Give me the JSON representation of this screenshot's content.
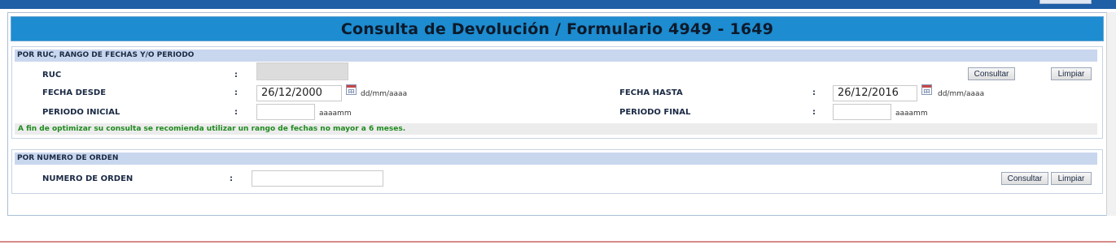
{
  "page_title": "Consulta de Devolución / Formulario 4949 - 1649",
  "colon": ":",
  "section_ruc": {
    "heading": "POR RUC, RANGO DE FECHAS Y/O PERIODO",
    "ruc_label": "RUC",
    "fecha_desde_label": "FECHA DESDE",
    "fecha_desde_value": "26/12/2000",
    "fecha_desde_hint": "dd/mm/aaaa",
    "fecha_hasta_label": "FECHA HASTA",
    "fecha_hasta_value": "26/12/2016",
    "fecha_hasta_hint": "dd/mm/aaaa",
    "periodo_inicial_label": "PERIODO INICIAL",
    "periodo_inicial_value": "",
    "periodo_inicial_hint": "aaaamm",
    "periodo_final_label": "PERIODO FINAL",
    "periodo_final_value": "",
    "periodo_final_hint": "aaaamm",
    "consultar_label": "Consultar",
    "limpiar_label": "Limpiar",
    "notice": "A fin de optimizar su consulta se recomienda utilizar un rango de fechas no mayor a 6 meses."
  },
  "section_orden": {
    "heading": "POR NUMERO DE ORDEN",
    "numero_label": "NUMERO DE ORDEN",
    "numero_value": "",
    "consultar_label": "Consultar",
    "limpiar_label": "Limpiar"
  },
  "colors": {
    "title_bar": "#1d8cd0",
    "section_header": "#c9d7ee",
    "notice_text": "#1f8a1f",
    "top_bar": "#1f5fa6"
  },
  "icons": [
    "calendar-icon"
  ]
}
